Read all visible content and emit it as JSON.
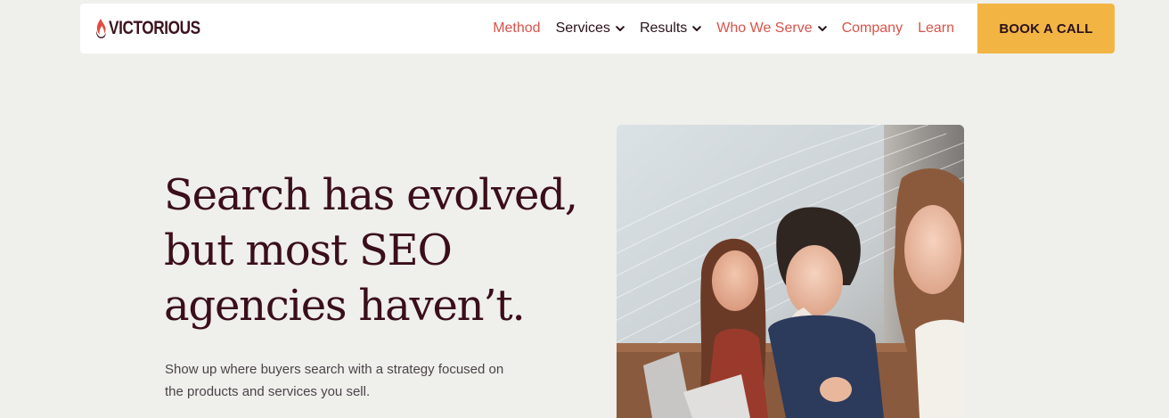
{
  "brand": {
    "name": "VICTORIOUS",
    "accent_color": "#d9534a",
    "dark_color": "#3a0e1a",
    "cta_color": "#f2b544"
  },
  "nav": {
    "items": [
      {
        "label": "Method",
        "has_dropdown": false,
        "style": "accent"
      },
      {
        "label": "Services",
        "has_dropdown": true,
        "style": "dark"
      },
      {
        "label": "Results",
        "has_dropdown": true,
        "style": "dark"
      },
      {
        "label": "Who We Serve",
        "has_dropdown": true,
        "style": "accent"
      },
      {
        "label": "Company",
        "has_dropdown": false,
        "style": "accent"
      },
      {
        "label": "Learn",
        "has_dropdown": false,
        "style": "accent"
      }
    ],
    "cta_label": "BOOK A CALL"
  },
  "hero": {
    "title_lines": [
      "Search has evolved,",
      "but most SEO",
      "agencies haven’t."
    ],
    "subtitle_lines": [
      "Show up where buyers search with a strategy focused on",
      "the products and services you sell."
    ]
  },
  "icons": {
    "logo": "flame-logo-icon",
    "dropdown": "chevron-down-icon"
  }
}
